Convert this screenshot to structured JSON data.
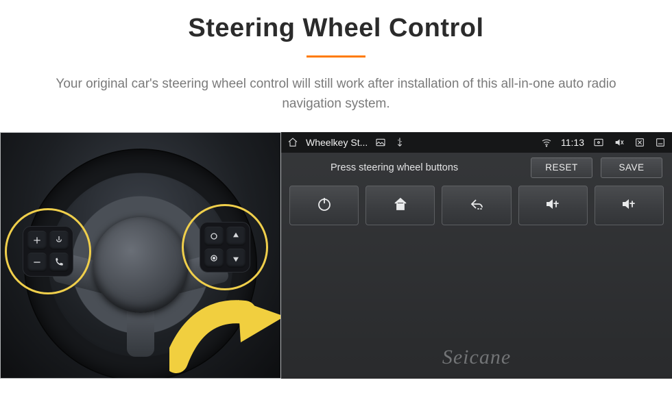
{
  "heading": "Steering Wheel Control",
  "description": "Your original car's steering wheel control will still work after installation of this all-in-one auto radio navigation system.",
  "status_bar": {
    "app_title": "Wheelkey St...",
    "time": "11:13"
  },
  "instruction": "Press steering wheel buttons",
  "buttons": {
    "reset": "RESET",
    "save": "SAVE"
  },
  "function_keys": [
    {
      "id": "power",
      "name": "power-icon"
    },
    {
      "id": "home",
      "name": "home-icon"
    },
    {
      "id": "back",
      "name": "back-icon"
    },
    {
      "id": "vol-up-1",
      "name": "volume-up-icon"
    },
    {
      "id": "vol-up-2",
      "name": "volume-up-icon"
    }
  ],
  "watermark": "Seicane",
  "wheel_buttons": {
    "left": [
      "plus-icon",
      "voice-icon",
      "minus-icon",
      "phone-icon"
    ],
    "right": [
      "mode-icon",
      "nav-up-icon",
      "cycle-icon",
      "nav-down-icon"
    ]
  }
}
